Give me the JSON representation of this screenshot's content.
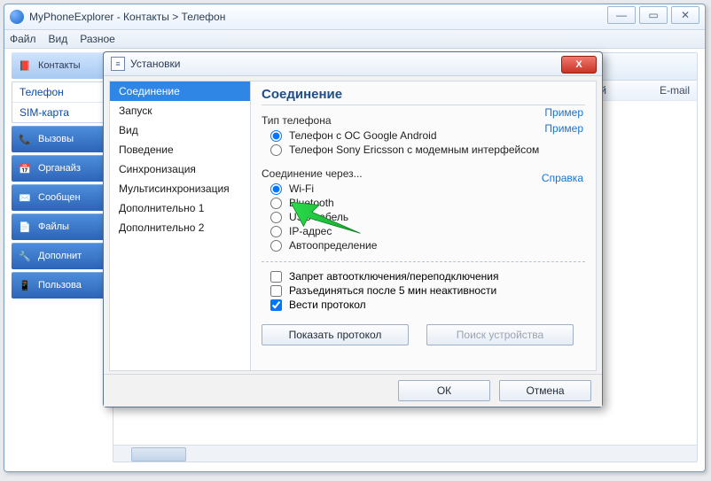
{
  "window": {
    "title": "MyPhoneExplorer  -  Контакты > Телефон",
    "menu": {
      "file": "Файл",
      "view": "Вид",
      "misc": "Разное"
    }
  },
  "sidebar": {
    "items": [
      {
        "label": "Контакты"
      },
      {
        "label": "Вызовы"
      },
      {
        "label": "Органайз"
      },
      {
        "label": "Сообщен"
      },
      {
        "label": "Файлы"
      },
      {
        "label": "Дополнит"
      },
      {
        "label": "Пользова"
      }
    ],
    "sub": [
      {
        "label": "Телефон"
      },
      {
        "label": "SIM-карта"
      }
    ]
  },
  "list": {
    "col_i": "й",
    "col_email": "E-mail"
  },
  "dialog": {
    "title": "Установки",
    "close": "X",
    "categories": [
      "Соединение",
      "Запуск",
      "Вид",
      "Поведение",
      "Синхронизация",
      "Мультисинхронизация",
      "Дополнительно 1",
      "Дополнительно 2"
    ],
    "panel": {
      "title": "Соединение",
      "group_phone": "Тип телефона",
      "phone_android": "Телефон с ОС Google Android",
      "phone_sony": "Телефон Sony Ericsson с модемным интерфейсом",
      "example": "Пример",
      "group_conn": "Соединение через...",
      "help": "Справка",
      "radios": [
        "Wi-Fi",
        "Bluetooth",
        "USB-кабель",
        "IP-адрес",
        "Автоопределение"
      ],
      "chk1": "Запрет автоотключения/переподключения",
      "chk2": "Разъединяться после 5 мин неактивности",
      "chk3": "Вести протокол",
      "show_protocol": "Показать протокол",
      "find_device": "Поиск устройства"
    },
    "ok": "ОК",
    "cancel": "Отмена"
  }
}
